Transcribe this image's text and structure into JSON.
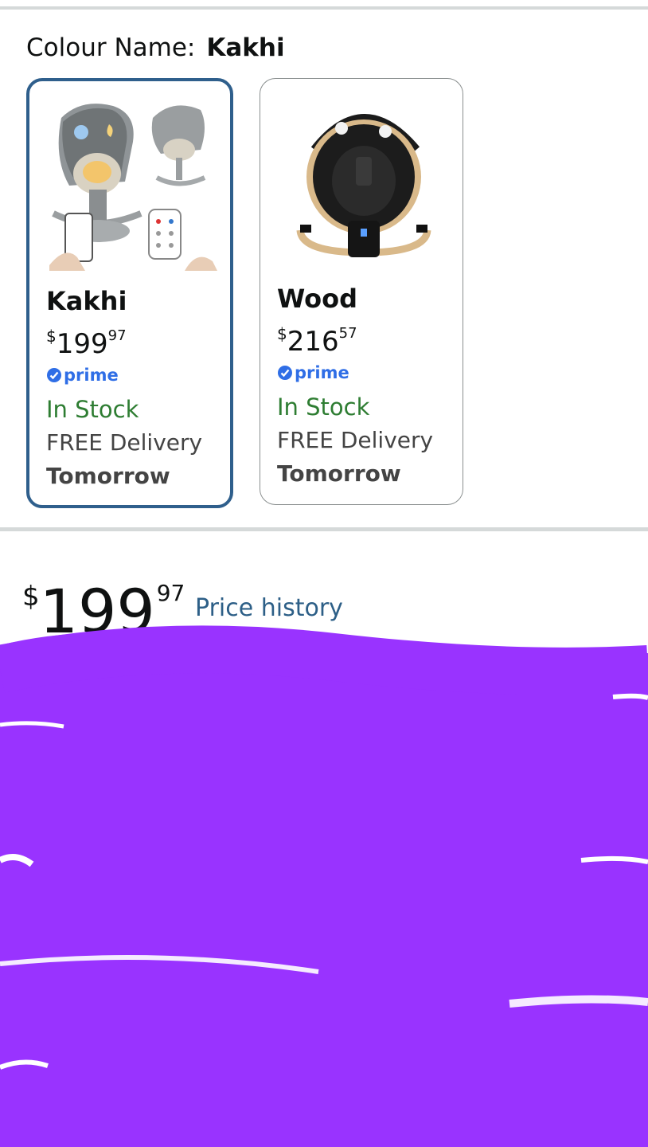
{
  "colour": {
    "label": "Colour Name:",
    "value": "Kakhi"
  },
  "variants": [
    {
      "name": "Kakhi",
      "price_currency": "$",
      "price_whole": "199",
      "price_fraction": "97",
      "prime": "prime",
      "stock": "In Stock",
      "delivery": "FREE Delivery",
      "delivery_day": "Tomorrow",
      "selected": true
    },
    {
      "name": "Wood",
      "price_currency": "$",
      "price_whole": "216",
      "price_fraction": "57",
      "prime": "prime",
      "stock": "In Stock",
      "delivery": "FREE Delivery",
      "delivery_day": "Tomorrow",
      "selected": false
    }
  ],
  "main_price": {
    "currency": "$",
    "whole": "199",
    "fraction": "97"
  },
  "price_history_link": "Price history",
  "colors": {
    "accent_border": "#2f5f8c",
    "stock_green": "#2e7d32",
    "prime_blue": "#2f6ee6",
    "link_blue": "#2d5f87",
    "redaction": "#9933ff"
  }
}
